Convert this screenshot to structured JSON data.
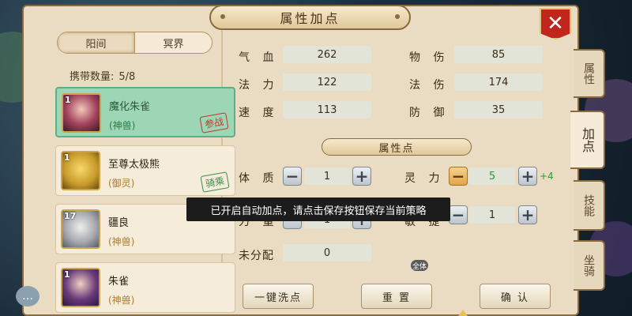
{
  "title": "属性加点",
  "close_label": "✕",
  "realm_tabs": [
    "阳间",
    "冥界"
  ],
  "carry": {
    "label": "携带数量:",
    "value": "5/8"
  },
  "pets": [
    {
      "level": "1",
      "name": "魔化朱雀",
      "kind": "(神兽)",
      "stamp": "参战",
      "stamp_color": "red",
      "selected": true
    },
    {
      "level": "1",
      "name": "至尊太极熊",
      "kind": "(御灵)",
      "stamp": "骑乘",
      "stamp_color": "green",
      "selected": false
    },
    {
      "level": "17",
      "name": "疆良",
      "kind": "(神兽)",
      "stamp": "",
      "selected": false
    },
    {
      "level": "1",
      "name": "朱雀",
      "kind": "(神兽)",
      "stamp": "",
      "selected": false
    }
  ],
  "stats": [
    {
      "label": "气 血",
      "value": "262"
    },
    {
      "label": "物 伤",
      "value": "85"
    },
    {
      "label": "法 力",
      "value": "122"
    },
    {
      "label": "法 伤",
      "value": "174"
    },
    {
      "label": "速 度",
      "value": "113"
    },
    {
      "label": "防 御",
      "value": "35"
    }
  ],
  "points_title": "属性点",
  "alloc": [
    {
      "label": "体 质",
      "value": "1",
      "bonus": ""
    },
    {
      "label": "灵 力",
      "value": "5",
      "bonus": "+4"
    },
    {
      "label": "力 量",
      "value": "1",
      "bonus": ""
    },
    {
      "label": "敏 捷",
      "value": "1",
      "bonus": ""
    }
  ],
  "unallocated": {
    "label": "未分配",
    "value": "0"
  },
  "tooltip": "已开启自动加点，请点击保存按钮保存当前策略",
  "buttons": {
    "wash": "一键洗点",
    "reset": "重 置",
    "confirm": "确 认"
  },
  "side_tabs": [
    "属性",
    "加点",
    "技能",
    "坐骑"
  ],
  "small_badge": "全体",
  "colors": {
    "accent_red": "#c1261c",
    "selected_green": "#9cd6b4",
    "bonus_green": "#2a9a3a"
  }
}
